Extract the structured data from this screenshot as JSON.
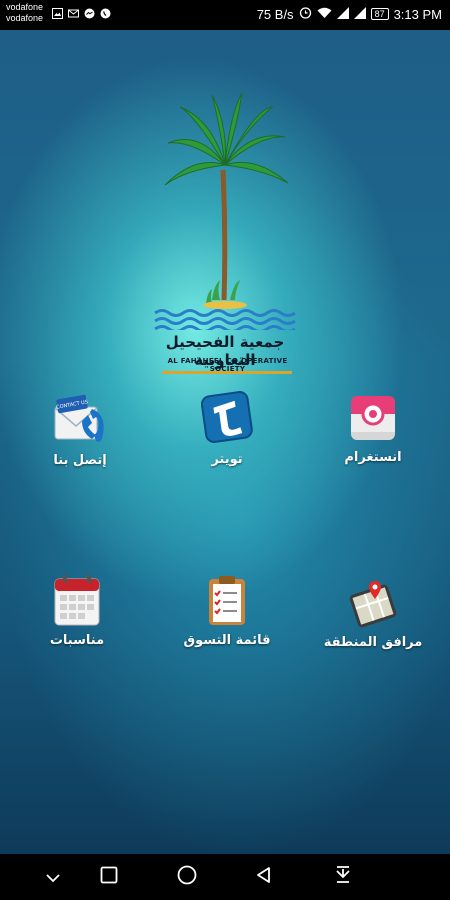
{
  "status_bar": {
    "carrier_line_1": "vodafone",
    "carrier_line_2": "vodafone",
    "net_speed": "75 B/s",
    "battery": "87",
    "time": "3:13 PM"
  },
  "logo": {
    "arabic_name": "جمعية الفحيحيل التعاونية",
    "english_name": "AL FAHAHEEL CO.OPERATIVE SOCIETY",
    "contact_badge_text": "CONTACT US"
  },
  "menu": {
    "contact_label": "إتصل بنا",
    "twitter_label": "تويتر",
    "instagram_label": "انستغرام",
    "occasions_label": "مناسبات",
    "shopping_list_label": "قائمة التسوق",
    "area_facilities_label": "مرافق المنطقة"
  },
  "colors": {
    "accent_gold": "#d9a52a",
    "instagram_pink": "#e0245e",
    "twitter_blue": "#1b8bd6"
  },
  "icons": {
    "back": "triangle-left",
    "home": "circle",
    "recents": "square",
    "collapse": "chevron-down",
    "notifications": "download-arrow"
  }
}
